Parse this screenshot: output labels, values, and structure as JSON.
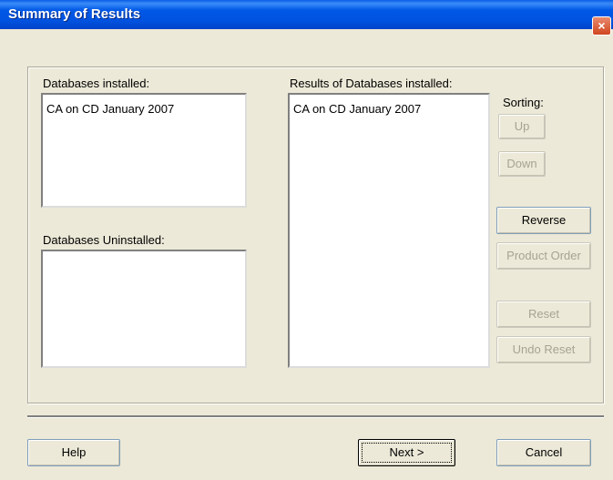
{
  "window": {
    "title": "Summary of Results",
    "close_glyph": "×"
  },
  "installed": {
    "label": "Databases installed:",
    "items": [
      "CA on CD January 2007"
    ]
  },
  "uninstalled": {
    "label": "Databases Uninstalled:",
    "items": []
  },
  "results": {
    "label": "Results of Databases installed:",
    "items": [
      "CA on CD January 2007"
    ]
  },
  "sorting": {
    "label": "Sorting:",
    "up": "Up",
    "down": "Down",
    "reverse": "Reverse",
    "product_order": "Product Order",
    "reset": "Reset",
    "undo_reset": "Undo Reset"
  },
  "footer": {
    "help": "Help",
    "next": "Next >",
    "cancel": "Cancel"
  }
}
